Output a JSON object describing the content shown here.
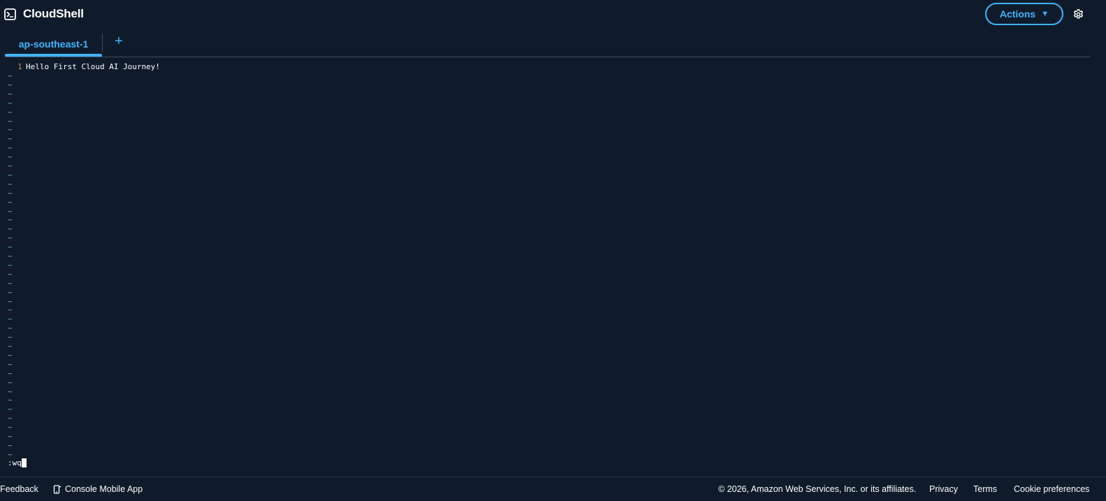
{
  "header": {
    "title": "CloudShell",
    "actions_label": "Actions",
    "actions_caret": "▼",
    "brand_icon": "terminal-icon",
    "settings_icon": "gear-icon"
  },
  "tabs": {
    "items": [
      {
        "label": "ap-southeast-1",
        "active": true
      }
    ],
    "add_label": "+"
  },
  "terminal": {
    "lines": [
      {
        "number": "1",
        "text": "Hello First Cloud AI Journey!"
      }
    ],
    "empty_marker": "~",
    "command": ":wq"
  },
  "footer": {
    "feedback": "Feedback",
    "mobile_app": "Console Mobile App",
    "copyright": "© 2026, Amazon Web Services, Inc. or its affiliates.",
    "privacy": "Privacy",
    "terms": "Terms",
    "cookie_preferences": "Cookie preferences"
  },
  "colors": {
    "background": "#0f1b2a",
    "accent": "#42b4ff",
    "line_number": "#c48b3a",
    "tilde": "#5aa6e8",
    "text": "#ffffff"
  }
}
